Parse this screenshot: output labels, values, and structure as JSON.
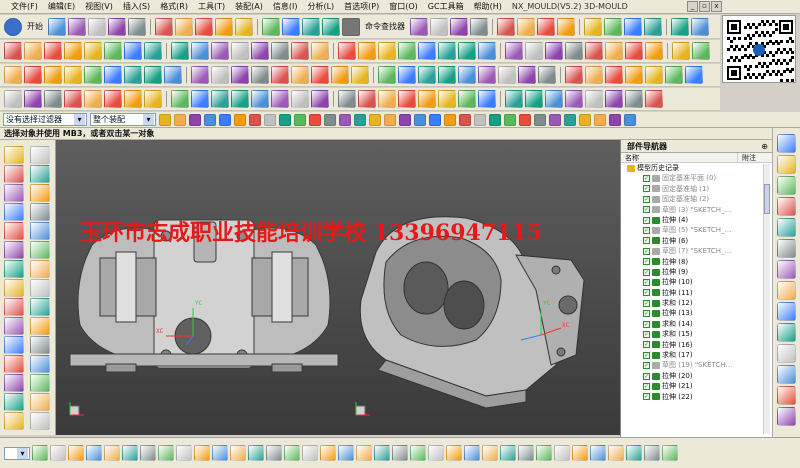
{
  "menu": {
    "items": [
      "文件(F)",
      "编辑(E)",
      "视图(V)",
      "插入(S)",
      "格式(R)",
      "工具(T)",
      "装配(A)",
      "信息(I)",
      "分析(L)",
      "首选项(P)",
      "窗口(O)",
      "GC工具箱",
      "帮助(H)"
    ],
    "title": "NX_MOULD(V5.2)   3D-MOULD"
  },
  "toolbar": {
    "start_label": "开始",
    "command_finder_label": "命令查找器"
  },
  "filter": {
    "selection_filter": "没有选择过滤器",
    "assembly_scope": "整个装配"
  },
  "prompt": "选择对象并使用 MB3，或者双击某一对象",
  "watermark": "玉环市志成职业技能培训学校  13396947115",
  "viewport": {
    "axis_labels": [
      "YC",
      "XC",
      "YC",
      "XC"
    ]
  },
  "navigator": {
    "title": "部件导航器",
    "col_name": "名称",
    "col_note": "附注",
    "items": [
      {
        "label": "模型历史记录",
        "state": "folder"
      },
      {
        "label": "固定基准平面 (0)",
        "state": "dim"
      },
      {
        "label": "固定基准轴 (1)",
        "state": "dim"
      },
      {
        "label": "固定基准轴 (2)",
        "state": "dim"
      },
      {
        "label": "草图 (3) \"SKETCH_…",
        "state": "dim"
      },
      {
        "label": "拉伸 (4)",
        "state": "normal"
      },
      {
        "label": "草图 (5) \"SKETCH_…",
        "state": "dim"
      },
      {
        "label": "拉伸 (6)",
        "state": "normal"
      },
      {
        "label": "草图 (7) \"SKETCH_…",
        "state": "dim"
      },
      {
        "label": "拉伸 (8)",
        "state": "normal"
      },
      {
        "label": "拉伸 (9)",
        "state": "normal"
      },
      {
        "label": "拉伸 (10)",
        "state": "normal"
      },
      {
        "label": "拉伸 (11)",
        "state": "normal"
      },
      {
        "label": "求和 (12)",
        "state": "normal"
      },
      {
        "label": "拉伸 (13)",
        "state": "normal"
      },
      {
        "label": "求和 (14)",
        "state": "normal"
      },
      {
        "label": "求和 (15)",
        "state": "normal"
      },
      {
        "label": "拉伸 (16)",
        "state": "normal"
      },
      {
        "label": "求和 (17)",
        "state": "normal"
      },
      {
        "label": "草图 (19) \"SKETCH…",
        "state": "dim"
      },
      {
        "label": "拉伸 (20)",
        "state": "normal"
      },
      {
        "label": "拉伸 (21)",
        "state": "normal"
      },
      {
        "label": "拉伸 (22)",
        "state": "normal"
      }
    ]
  },
  "colors": {
    "watermark": "#e81818",
    "viewport_top": "#5e5e5e",
    "viewport_bottom": "#3a3a3a",
    "panel": "#ece9d8",
    "model": "#c8c8c8"
  }
}
